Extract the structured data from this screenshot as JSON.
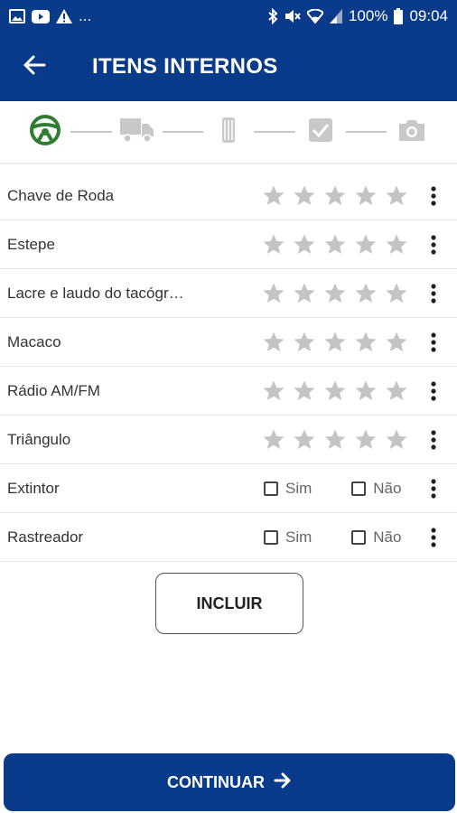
{
  "status_bar": {
    "battery": "100%",
    "time": "09:04",
    "overflow": "...",
    "left_icons": [
      "image-icon",
      "youtube-icon",
      "warning-icon"
    ],
    "right_icons": [
      "bluetooth-icon",
      "mute-icon",
      "wifi-icon",
      "signal-icon",
      "battery-icon"
    ]
  },
  "app_bar": {
    "title": "ITENS INTERNOS"
  },
  "stepper": {
    "steps": [
      {
        "icon": "steering-wheel-icon",
        "active": true
      },
      {
        "icon": "truck-icon",
        "active": false
      },
      {
        "icon": "tire-icon",
        "active": false
      },
      {
        "icon": "checkbox-icon",
        "active": false
      },
      {
        "icon": "camera-icon",
        "active": false
      }
    ],
    "active_color": "#2e7d32",
    "inactive_color": "#c8c8c8"
  },
  "items": [
    {
      "label": "Chave de Roda",
      "type": "rating",
      "rating": 0,
      "max": 5
    },
    {
      "label": "Estepe",
      "type": "rating",
      "rating": 0,
      "max": 5
    },
    {
      "label": "Lacre e laudo do tacógr…",
      "type": "rating",
      "rating": 0,
      "max": 5
    },
    {
      "label": "Macaco",
      "type": "rating",
      "rating": 0,
      "max": 5
    },
    {
      "label": "Rádio AM/FM",
      "type": "rating",
      "rating": 0,
      "max": 5
    },
    {
      "label": "Triângulo",
      "type": "rating",
      "rating": 0,
      "max": 5
    },
    {
      "label": "Extintor",
      "type": "check",
      "yes_label": "Sim",
      "no_label": "Não"
    },
    {
      "label": "Rastreador",
      "type": "check",
      "yes_label": "Sim",
      "no_label": "Não"
    }
  ],
  "buttons": {
    "incluir": "INCLUIR",
    "continuar": "CONTINUAR"
  },
  "colors": {
    "primary": "#0a3a8a",
    "star": "#c4c4c4"
  }
}
